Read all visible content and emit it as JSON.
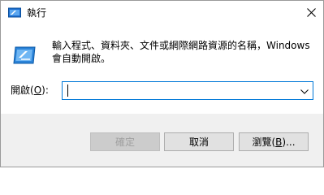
{
  "window": {
    "title": "執行"
  },
  "content": {
    "description_line1": "輸入程式、資料夾、文件或網際網路資源的名稱，Windows",
    "description_line2": "會自動開啟。",
    "open_label_prefix": "開啟(",
    "open_label_key": "O",
    "open_label_suffix": "):",
    "input_value": ""
  },
  "buttons": {
    "ok_label": "確定",
    "cancel_label": "取消",
    "browse_prefix": "瀏覽(",
    "browse_key": "B",
    "browse_suffix": ")..."
  },
  "colors": {
    "accent": "#0078d7",
    "footer_bg": "#f0f0f0",
    "button_bg": "#e1e1e1",
    "disabled_text": "#a0a0a0"
  },
  "icons": {
    "app": "run-app-icon",
    "run": "run-program-icon",
    "close": "close-icon",
    "dropdown": "chevron-down-icon"
  }
}
